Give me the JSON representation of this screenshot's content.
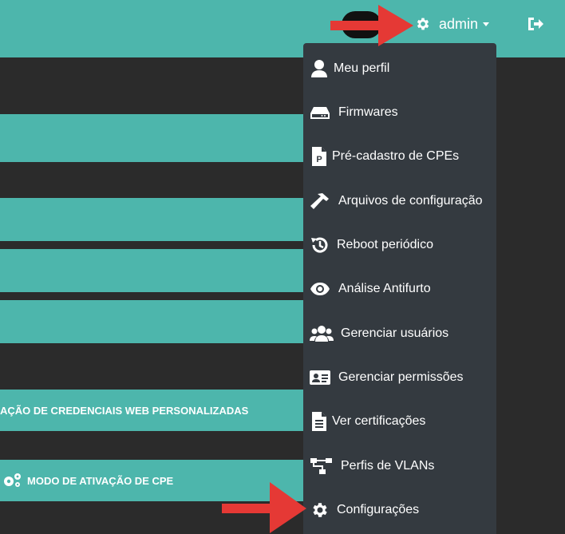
{
  "header": {
    "user_label": "admin",
    "settings_icon": "gear-icon",
    "logout_icon": "sign-out-icon",
    "accent_color": "#4db6ac"
  },
  "bands": {
    "credentials_label": "AÇÃO DE CREDENCIAIS WEB PERSONALIZADAS",
    "activation_label": "MODO DE ATIVAÇÃO DE CPE"
  },
  "menu": {
    "items": [
      {
        "label": "Meu perfil",
        "icon": "user-icon"
      },
      {
        "label": "Firmwares",
        "icon": "hdd-icon"
      },
      {
        "label": "Pré-cadastro de CPEs",
        "icon": "file-p-icon"
      },
      {
        "label": "Arquivos de configuração",
        "icon": "hammer-icon"
      },
      {
        "label": "Reboot periódico",
        "icon": "history-icon"
      },
      {
        "label": "Análise Antifurto",
        "icon": "eye-icon"
      },
      {
        "label": "Gerenciar usuários",
        "icon": "users-icon"
      },
      {
        "label": "Gerenciar permissões",
        "icon": "id-card-icon"
      },
      {
        "label": "Ver certificações",
        "icon": "file-text-icon"
      },
      {
        "label": "Perfis de VLANs",
        "icon": "network-icon"
      },
      {
        "label": "Configurações",
        "icon": "gear-icon"
      }
    ]
  }
}
